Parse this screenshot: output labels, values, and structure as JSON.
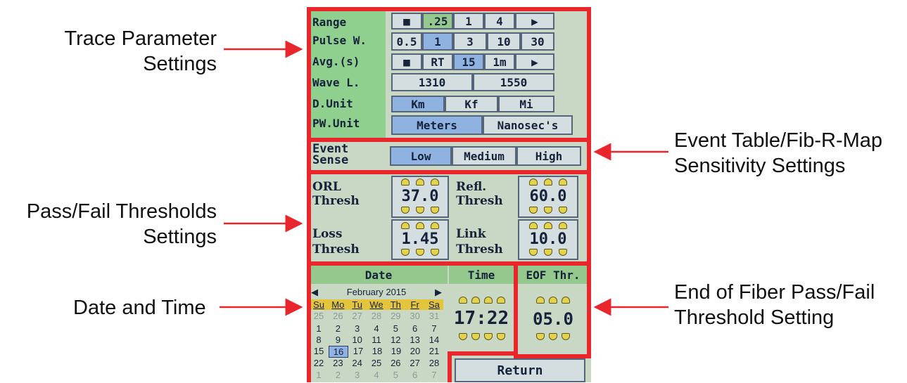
{
  "callouts": {
    "trace_params": [
      "Trace Parameter",
      "Settings"
    ],
    "event_sense": [
      "Event Table/Fib-R-Map",
      "Sensitivity Settings"
    ],
    "pass_fail": [
      "Pass/Fail Thresholds",
      "Settings"
    ],
    "date_time": "Date and Time",
    "eof": [
      "End of Fiber Pass/Fail",
      "Threshold Setting"
    ]
  },
  "colors": {
    "callout_red": "#e8262c",
    "selected": "#8fb2e0",
    "label_green": "#8fd08f"
  },
  "trace": {
    "range": {
      "label": "Range",
      "options": [
        "■",
        ".25",
        "1",
        "4",
        "▶"
      ],
      "selected": ".25"
    },
    "pulse": {
      "label": "Pulse W.",
      "options": [
        "0.5",
        "1",
        "3",
        "10",
        "30"
      ],
      "selected": "1"
    },
    "avg": {
      "label": "Avg.(s)",
      "options": [
        "■",
        "RT",
        "15",
        "1m",
        "▶"
      ],
      "selected": "15"
    },
    "wave": {
      "label": "Wave L.",
      "options": [
        "1310",
        "1550"
      ]
    },
    "dunit": {
      "label": "D.Unit",
      "options": [
        "Km",
        "Kf",
        "Mi"
      ],
      "selected": "Km"
    },
    "pwunit": {
      "label": "PW.Unit",
      "options": [
        "Meters",
        "Nanosec's"
      ],
      "selected": "Meters"
    }
  },
  "event": {
    "label1": "Event",
    "label2": "Sense",
    "options": [
      "Low",
      "Medium",
      "High"
    ],
    "selected": "Low"
  },
  "thresholds": {
    "orl": {
      "l1": "ORL",
      "l2": "Thresh",
      "value": "37.0"
    },
    "refl": {
      "l1": "Refl.",
      "l2": "Thresh",
      "value": "60.0"
    },
    "loss": {
      "l1": "Loss",
      "l2": "Thresh",
      "value": "1.45"
    },
    "link": {
      "l1": "Link",
      "l2": "Thresh",
      "value": "10.0"
    }
  },
  "datetime": {
    "date_header": "Date",
    "time_header": "Time",
    "eof_header": "EOF Thr.",
    "month": "February 2015",
    "weekdays": [
      "Su",
      "Mo",
      "Tu",
      "We",
      "Th",
      "Fr",
      "Sa"
    ],
    "weeks": [
      [
        "25",
        "26",
        "27",
        "28",
        "29",
        "30",
        "31"
      ],
      [
        "1",
        "2",
        "3",
        "4",
        "5",
        "6",
        "7"
      ],
      [
        "8",
        "9",
        "10",
        "11",
        "12",
        "13",
        "14"
      ],
      [
        "15",
        "16",
        "17",
        "18",
        "19",
        "20",
        "21"
      ],
      [
        "22",
        "23",
        "24",
        "25",
        "26",
        "27",
        "28"
      ],
      [
        "1",
        "2",
        "3",
        "4",
        "5",
        "6",
        "7"
      ]
    ],
    "selected_day": "16",
    "time": "17:22",
    "eof_value": "05.0",
    "return_label": "Return"
  }
}
